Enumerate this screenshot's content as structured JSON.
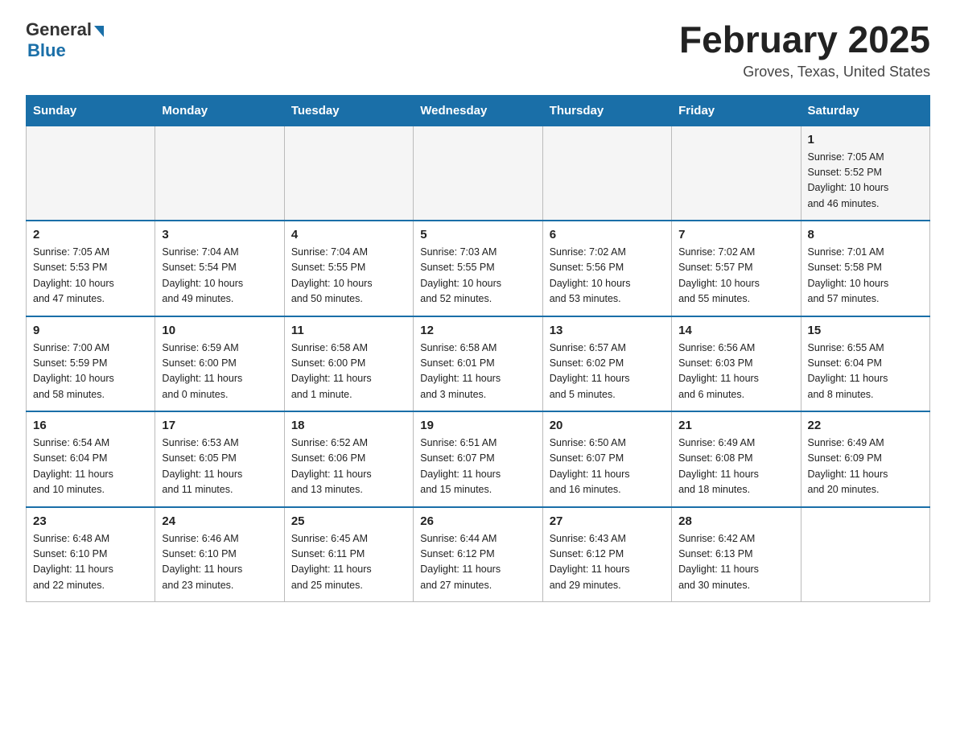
{
  "header": {
    "logo_general": "General",
    "logo_blue": "Blue",
    "main_title": "February 2025",
    "subtitle": "Groves, Texas, United States"
  },
  "days_of_week": [
    "Sunday",
    "Monday",
    "Tuesday",
    "Wednesday",
    "Thursday",
    "Friday",
    "Saturday"
  ],
  "weeks": [
    [
      {
        "day": "",
        "info": ""
      },
      {
        "day": "",
        "info": ""
      },
      {
        "day": "",
        "info": ""
      },
      {
        "day": "",
        "info": ""
      },
      {
        "day": "",
        "info": ""
      },
      {
        "day": "",
        "info": ""
      },
      {
        "day": "1",
        "info": "Sunrise: 7:05 AM\nSunset: 5:52 PM\nDaylight: 10 hours\nand 46 minutes."
      }
    ],
    [
      {
        "day": "2",
        "info": "Sunrise: 7:05 AM\nSunset: 5:53 PM\nDaylight: 10 hours\nand 47 minutes."
      },
      {
        "day": "3",
        "info": "Sunrise: 7:04 AM\nSunset: 5:54 PM\nDaylight: 10 hours\nand 49 minutes."
      },
      {
        "day": "4",
        "info": "Sunrise: 7:04 AM\nSunset: 5:55 PM\nDaylight: 10 hours\nand 50 minutes."
      },
      {
        "day": "5",
        "info": "Sunrise: 7:03 AM\nSunset: 5:55 PM\nDaylight: 10 hours\nand 52 minutes."
      },
      {
        "day": "6",
        "info": "Sunrise: 7:02 AM\nSunset: 5:56 PM\nDaylight: 10 hours\nand 53 minutes."
      },
      {
        "day": "7",
        "info": "Sunrise: 7:02 AM\nSunset: 5:57 PM\nDaylight: 10 hours\nand 55 minutes."
      },
      {
        "day": "8",
        "info": "Sunrise: 7:01 AM\nSunset: 5:58 PM\nDaylight: 10 hours\nand 57 minutes."
      }
    ],
    [
      {
        "day": "9",
        "info": "Sunrise: 7:00 AM\nSunset: 5:59 PM\nDaylight: 10 hours\nand 58 minutes."
      },
      {
        "day": "10",
        "info": "Sunrise: 6:59 AM\nSunset: 6:00 PM\nDaylight: 11 hours\nand 0 minutes."
      },
      {
        "day": "11",
        "info": "Sunrise: 6:58 AM\nSunset: 6:00 PM\nDaylight: 11 hours\nand 1 minute."
      },
      {
        "day": "12",
        "info": "Sunrise: 6:58 AM\nSunset: 6:01 PM\nDaylight: 11 hours\nand 3 minutes."
      },
      {
        "day": "13",
        "info": "Sunrise: 6:57 AM\nSunset: 6:02 PM\nDaylight: 11 hours\nand 5 minutes."
      },
      {
        "day": "14",
        "info": "Sunrise: 6:56 AM\nSunset: 6:03 PM\nDaylight: 11 hours\nand 6 minutes."
      },
      {
        "day": "15",
        "info": "Sunrise: 6:55 AM\nSunset: 6:04 PM\nDaylight: 11 hours\nand 8 minutes."
      }
    ],
    [
      {
        "day": "16",
        "info": "Sunrise: 6:54 AM\nSunset: 6:04 PM\nDaylight: 11 hours\nand 10 minutes."
      },
      {
        "day": "17",
        "info": "Sunrise: 6:53 AM\nSunset: 6:05 PM\nDaylight: 11 hours\nand 11 minutes."
      },
      {
        "day": "18",
        "info": "Sunrise: 6:52 AM\nSunset: 6:06 PM\nDaylight: 11 hours\nand 13 minutes."
      },
      {
        "day": "19",
        "info": "Sunrise: 6:51 AM\nSunset: 6:07 PM\nDaylight: 11 hours\nand 15 minutes."
      },
      {
        "day": "20",
        "info": "Sunrise: 6:50 AM\nSunset: 6:07 PM\nDaylight: 11 hours\nand 16 minutes."
      },
      {
        "day": "21",
        "info": "Sunrise: 6:49 AM\nSunset: 6:08 PM\nDaylight: 11 hours\nand 18 minutes."
      },
      {
        "day": "22",
        "info": "Sunrise: 6:49 AM\nSunset: 6:09 PM\nDaylight: 11 hours\nand 20 minutes."
      }
    ],
    [
      {
        "day": "23",
        "info": "Sunrise: 6:48 AM\nSunset: 6:10 PM\nDaylight: 11 hours\nand 22 minutes."
      },
      {
        "day": "24",
        "info": "Sunrise: 6:46 AM\nSunset: 6:10 PM\nDaylight: 11 hours\nand 23 minutes."
      },
      {
        "day": "25",
        "info": "Sunrise: 6:45 AM\nSunset: 6:11 PM\nDaylight: 11 hours\nand 25 minutes."
      },
      {
        "day": "26",
        "info": "Sunrise: 6:44 AM\nSunset: 6:12 PM\nDaylight: 11 hours\nand 27 minutes."
      },
      {
        "day": "27",
        "info": "Sunrise: 6:43 AM\nSunset: 6:12 PM\nDaylight: 11 hours\nand 29 minutes."
      },
      {
        "day": "28",
        "info": "Sunrise: 6:42 AM\nSunset: 6:13 PM\nDaylight: 11 hours\nand 30 minutes."
      },
      {
        "day": "",
        "info": ""
      }
    ]
  ]
}
